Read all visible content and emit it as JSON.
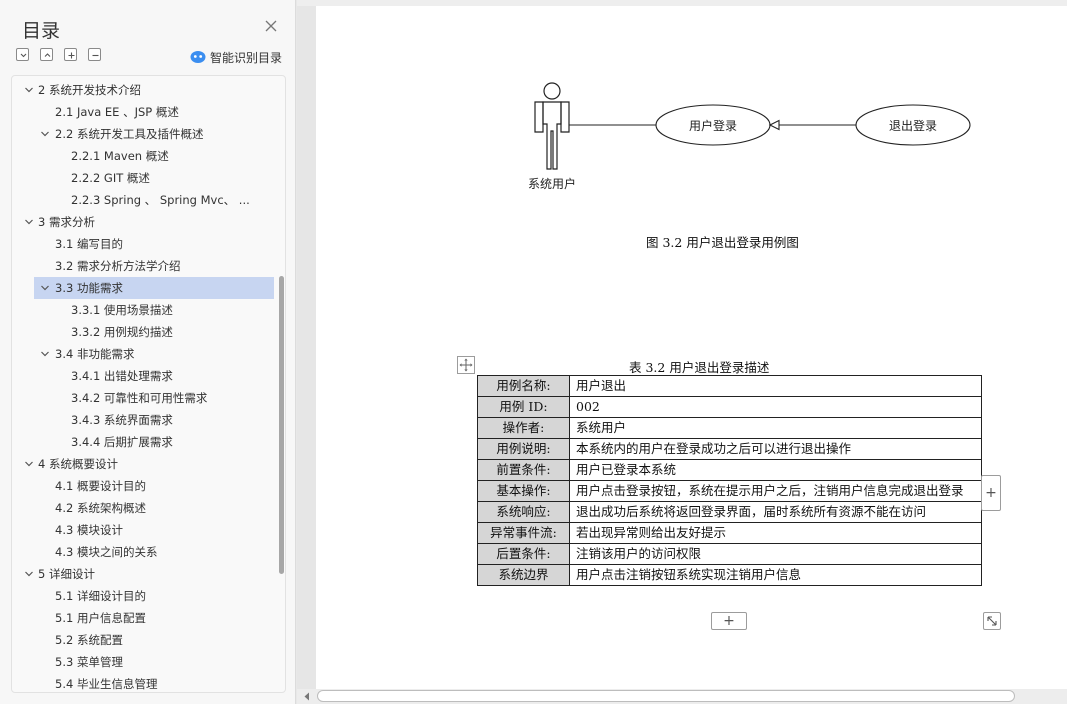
{
  "sidebar": {
    "title": "目录",
    "ai_button_label": "智能识别目录",
    "toc": [
      {
        "label": "2   系统开发技术介绍",
        "level": 0,
        "expanded": true
      },
      {
        "label": "2.1    Java EE  、JSP 概述",
        "level": 1
      },
      {
        "label": "2.2 系统开发工具及插件概述",
        "level": 1,
        "expanded": true
      },
      {
        "label": "2.2.1 Maven  概述",
        "level": 2
      },
      {
        "label": "2.2.2 GIT  概述",
        "level": 2
      },
      {
        "label": "2.2.3 Spring  、  Spring Mvc、 ...",
        "level": 2
      },
      {
        "label": "3     需求分析",
        "level": 0,
        "expanded": true
      },
      {
        "label": "3.1  编写目的",
        "level": 1
      },
      {
        "label": "3.2  需求分析方法学介绍",
        "level": 1
      },
      {
        "label": "3.3 功能需求",
        "level": 1,
        "expanded": true,
        "selected": true
      },
      {
        "label": "3.3.1 使用场景描述",
        "level": 2
      },
      {
        "label": "3.3.2 用例规约描述",
        "level": 2
      },
      {
        "label": "3.4  非功能需求",
        "level": 1,
        "expanded": true
      },
      {
        "label": "3.4.1  出错处理需求",
        "level": 2
      },
      {
        "label": "3.4.2  可靠性和可用性需求",
        "level": 2
      },
      {
        "label": "3.4.3  系统界面需求",
        "level": 2
      },
      {
        "label": "3.4.4  后期扩展需求",
        "level": 2
      },
      {
        "label": "4    系统概要设计",
        "level": 0,
        "expanded": true
      },
      {
        "label": "4.1  概要设计目的",
        "level": 1
      },
      {
        "label": "4.2  系统架构概述",
        "level": 1
      },
      {
        "label": "4.3  模块设计",
        "level": 1
      },
      {
        "label": "4.3  模块之间的关系",
        "level": 1
      },
      {
        "label": "5  详细设计",
        "level": 0,
        "expanded": true
      },
      {
        "label": "5.1  详细设计目的",
        "level": 1
      },
      {
        "label": "5.1  用户信息配置",
        "level": 1
      },
      {
        "label": "5.2  系统配置",
        "level": 1
      },
      {
        "label": "5.3  菜单管理",
        "level": 1
      },
      {
        "label": "5.4  毕业生信息管理",
        "level": 1
      }
    ]
  },
  "diagram": {
    "actor_label": "系统用户",
    "usecase_login": "用户登录",
    "usecase_logout": "退出登录",
    "caption": "图  3.2  用户退出登录用例图"
  },
  "table": {
    "caption": "表  3.2  用户退出登录描述",
    "rows": [
      {
        "label": "用例名称:",
        "value": "用户退出"
      },
      {
        "label": "用例 ID:",
        "value": "002"
      },
      {
        "label": "操作者:",
        "value": "系统用户"
      },
      {
        "label": "用例说明:",
        "value": "本系统内的用户在登录成功之后可以进行退出操作"
      },
      {
        "label": "前置条件:",
        "value": "用户已登录本系统"
      },
      {
        "label": "基本操作:",
        "value": "用户点击登录按钮，系统在提示用户之后，注销用户信息完成退出登录"
      },
      {
        "label": "系统响应:",
        "value": "退出成功后系统将返回登录界面，届时系统所有资源不能在访问"
      },
      {
        "label": "异常事件流:",
        "value": "若出现异常则给出友好提示"
      },
      {
        "label": "后置条件:",
        "value": "注销该用户的访问权限"
      },
      {
        "label": "系统边界",
        "value": "用户点击注销按钮系统实现注销用户信息"
      }
    ],
    "add_symbol": "+"
  },
  "colors": {
    "selected_row": "#c7d5f1",
    "label_cell": "#d6d6d6",
    "ai_icon": "#3b8ef0"
  }
}
